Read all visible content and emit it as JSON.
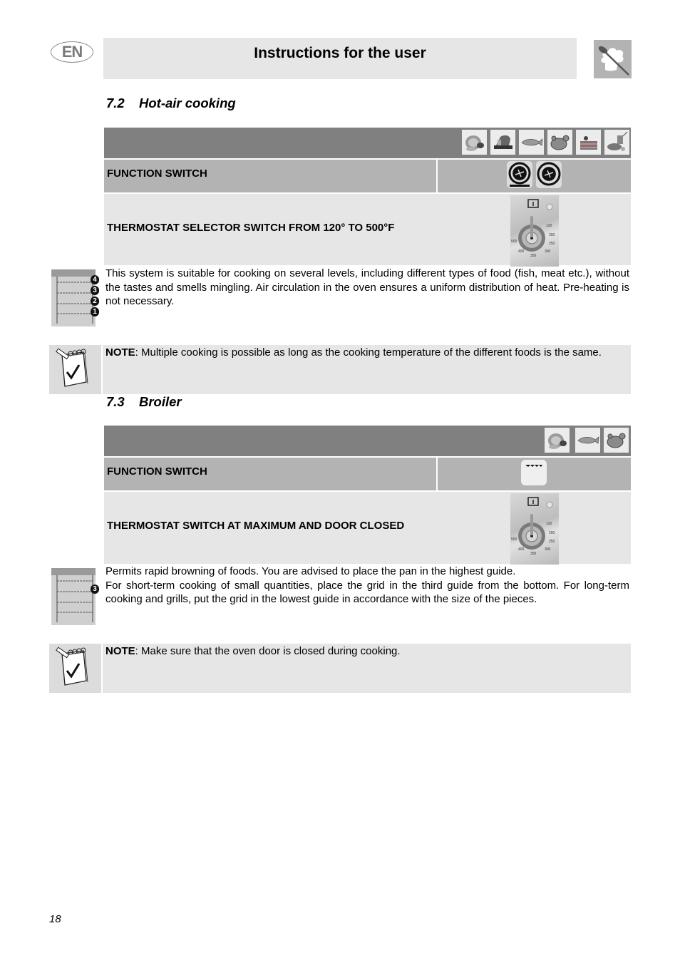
{
  "header": {
    "language_badge": "EN",
    "title": "Instructions for the user",
    "logo_icon": "chef-hat-spoon-icon"
  },
  "sections": [
    {
      "number": "7.2",
      "title": "Hot-air cooking",
      "food_icons": [
        "meat-icon",
        "bread-icon",
        "fish-icon",
        "poultry-icon",
        "cake-icon",
        "vegetables-icon"
      ],
      "rows": {
        "function_switch": {
          "label": "FUNCTION SWITCH",
          "icons": [
            "fan-with-bottom-heater-icon",
            "fan-icon"
          ]
        },
        "thermostat": {
          "label": "THERMOSTAT SELECTOR SWITCH FROM 120° TO 500°F",
          "icon": "thermostat-dial-icon",
          "dial_marks": [
            "120",
            "200",
            "250",
            "300",
            "350",
            "400",
            "500"
          ]
        }
      },
      "rack_levels": [
        "4",
        "3",
        "2",
        "1"
      ],
      "description": [
        "This system is suitable for cooking on several levels, including different types of food (fish, meat etc.), without the tastes and smells mingling. Air circulation in the oven ensures a uniform distribution of heat. Pre-heating is not necessary."
      ],
      "note": {
        "label": "NOTE",
        "text": ": Multiple cooking is possible as long as the cooking temperature of the different foods is the same."
      }
    },
    {
      "number": "7.3",
      "title": "Broiler",
      "food_icons": [
        "meat-icon",
        "fish-icon",
        "poultry-icon"
      ],
      "rows": {
        "function_switch": {
          "label": "FUNCTION SWITCH",
          "icons": [
            "broiler-element-icon"
          ]
        },
        "thermostat": {
          "label": "THERMOSTAT SWITCH AT MAXIMUM AND DOOR CLOSED",
          "icon": "thermostat-dial-icon",
          "dial_marks": [
            "120",
            "200",
            "250",
            "300",
            "350",
            "400",
            "500"
          ]
        }
      },
      "rack_levels": [
        "3"
      ],
      "description": [
        "Permits rapid browning of foods. You are advised to place the pan in the highest guide.",
        "For short-term cooking of small quantities, place the grid in the third guide from the bottom. For long-term cooking and grills, put the grid in the lowest guide in accordance with the size of the pieces."
      ],
      "note": {
        "label": "NOTE",
        "text": ": Make sure that the oven door is closed during cooking."
      }
    }
  ],
  "footer": {
    "page_number": "18"
  }
}
